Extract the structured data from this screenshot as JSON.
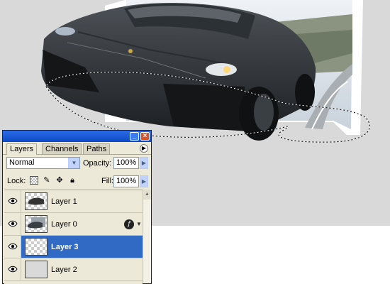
{
  "panel": {
    "tabs": [
      {
        "label": "Layers",
        "active": true
      },
      {
        "label": "Channels",
        "active": false
      },
      {
        "label": "Paths",
        "active": false
      }
    ],
    "blend_mode": "Normal",
    "opacity_label": "Opacity:",
    "opacity_value": "100%",
    "lock_label": "Lock:",
    "fill_label": "Fill:",
    "fill_value": "100%",
    "layers": [
      {
        "name": "Layer 1",
        "visible": true,
        "selected": false,
        "has_effects": false
      },
      {
        "name": "Layer 0",
        "visible": true,
        "selected": false,
        "has_effects": true
      },
      {
        "name": "Layer 3",
        "visible": true,
        "selected": true,
        "has_effects": false
      },
      {
        "name": "Layer 2",
        "visible": true,
        "selected": false,
        "has_effects": false
      }
    ]
  },
  "icons": {
    "eye": "eye-icon",
    "fx": "layer-effects-icon",
    "lock_transparent": "lock-transparent-pixels-icon",
    "lock_image": "lock-image-pixels-icon",
    "lock_position": "lock-position-icon",
    "lock_all": "lock-all-icon"
  },
  "colors": {
    "canvas_bg": "#d9d9d9",
    "selection_highlight": "#316ac5",
    "titlebar": "#0a48c8"
  }
}
